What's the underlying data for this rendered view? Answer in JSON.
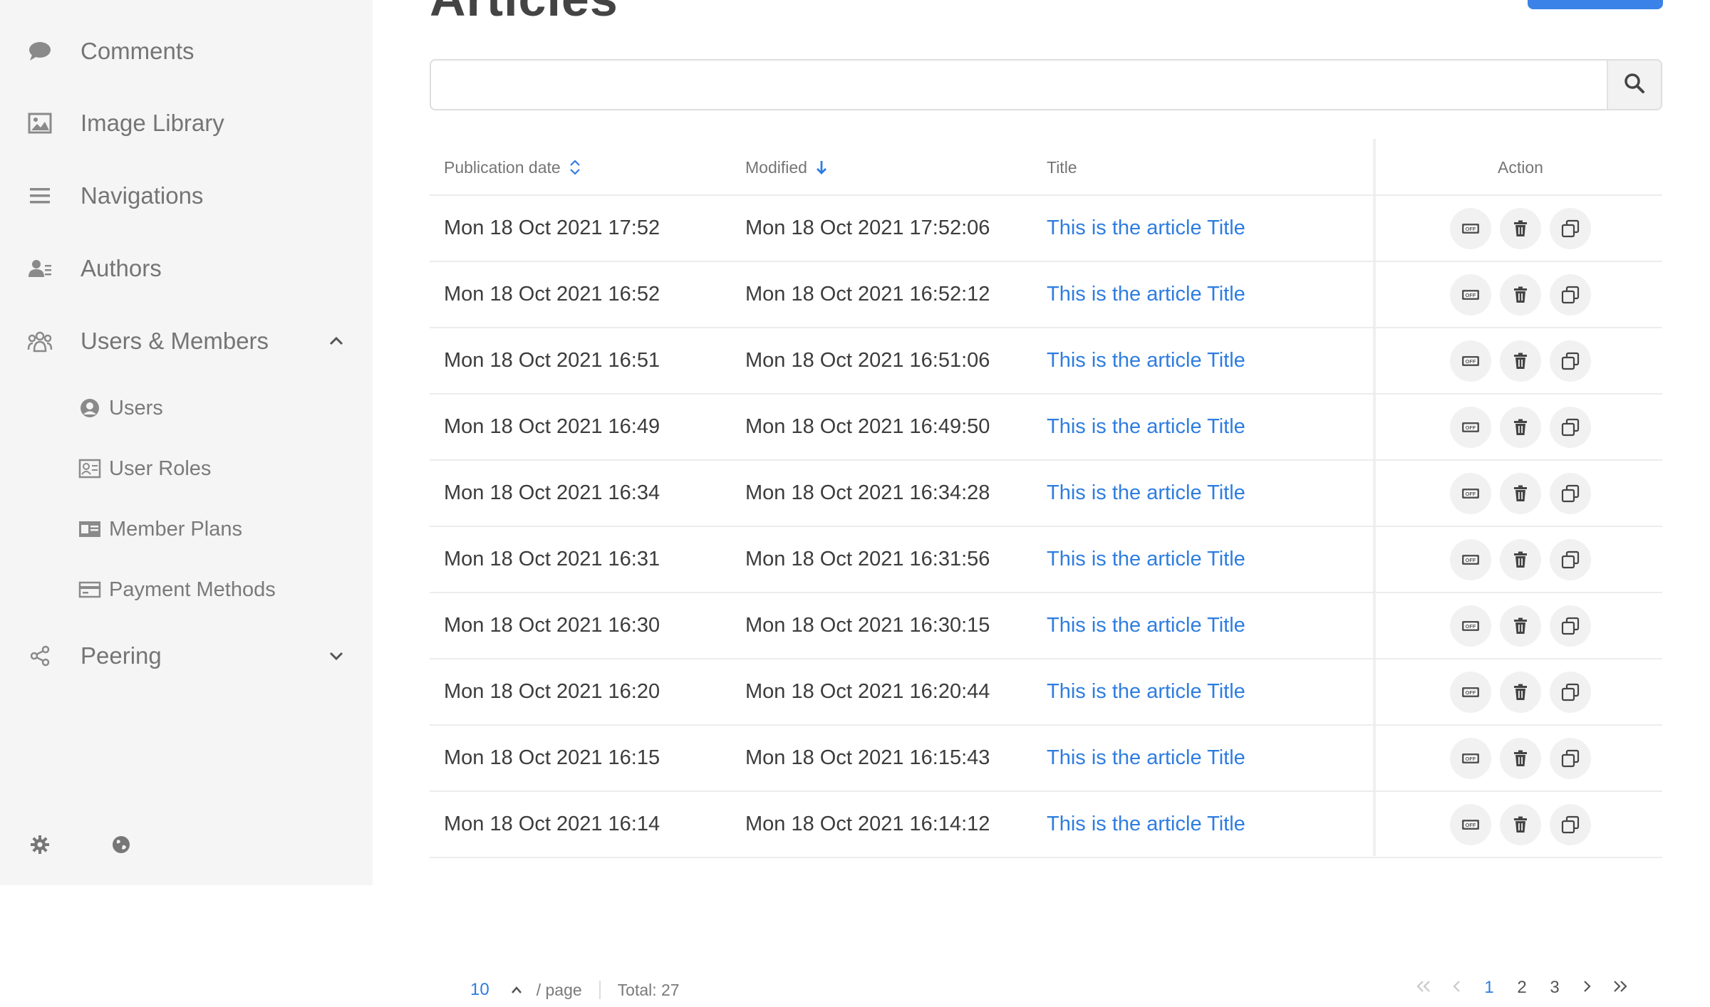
{
  "sidebar": {
    "items": [
      {
        "label": "Comments",
        "icon": "comment-icon"
      },
      {
        "label": "Image Library",
        "icon": "image-icon"
      },
      {
        "label": "Navigations",
        "icon": "menu-icon"
      },
      {
        "label": "Authors",
        "icon": "authors-icon"
      },
      {
        "label": "Users & Members",
        "icon": "people-icon",
        "expanded": true
      },
      {
        "label": "Peering",
        "icon": "share-icon",
        "expanded": false
      }
    ],
    "subitems": [
      {
        "label": "Users",
        "icon": "user-circle-icon"
      },
      {
        "label": "User Roles",
        "icon": "user-roles-icon"
      },
      {
        "label": "Member Plans",
        "icon": "id-card-icon"
      },
      {
        "label": "Payment Methods",
        "icon": "credit-card-icon"
      }
    ],
    "footer": {
      "settings_icon": "gear-icon",
      "language_icon": "globe-icon"
    }
  },
  "main": {
    "title": "Articles",
    "search": {
      "value": "",
      "placeholder": ""
    },
    "columns": {
      "publication_date": "Publication date",
      "modified": "Modified",
      "title": "Title",
      "action": "Action"
    },
    "rows": [
      {
        "pub": "Mon 18 Oct 2021 17:52",
        "mod": "Mon 18 Oct 2021 17:52:06",
        "title": "This is the article Title"
      },
      {
        "pub": "Mon 18 Oct 2021 16:52",
        "mod": "Mon 18 Oct 2021 16:52:12",
        "title": "This is the article Title"
      },
      {
        "pub": "Mon 18 Oct 2021 16:51",
        "mod": "Mon 18 Oct 2021 16:51:06",
        "title": "This is the article Title"
      },
      {
        "pub": "Mon 18 Oct 2021 16:49",
        "mod": "Mon 18 Oct 2021 16:49:50",
        "title": "This is the article Title"
      },
      {
        "pub": "Mon 18 Oct 2021 16:34",
        "mod": "Mon 18 Oct 2021 16:34:28",
        "title": "This is the article Title"
      },
      {
        "pub": "Mon 18 Oct 2021 16:31",
        "mod": "Mon 18 Oct 2021 16:31:56",
        "title": "This is the article Title"
      },
      {
        "pub": "Mon 18 Oct 2021 16:30",
        "mod": "Mon 18 Oct 2021 16:30:15",
        "title": "This is the article Title"
      },
      {
        "pub": "Mon 18 Oct 2021 16:20",
        "mod": "Mon 18 Oct 2021 16:20:44",
        "title": "This is the article Title"
      },
      {
        "pub": "Mon 18 Oct 2021 16:15",
        "mod": "Mon 18 Oct 2021 16:15:43",
        "title": "This is the article Title"
      },
      {
        "pub": "Mon 18 Oct 2021 16:14",
        "mod": "Mon 18 Oct 2021 16:14:12",
        "title": "This is the article Title"
      }
    ],
    "row_actions": [
      "off-toggle-icon",
      "trash-icon",
      "duplicate-icon"
    ]
  },
  "pagination": {
    "page_size": "10",
    "per_page_label": "/ page",
    "total": "Total: 27",
    "pages": [
      "1",
      "2",
      "3"
    ],
    "current_page": "1"
  },
  "colors": {
    "accent": "#2e7de0",
    "sidebar_bg": "#f5f5f5",
    "button": "#3b82e8"
  }
}
